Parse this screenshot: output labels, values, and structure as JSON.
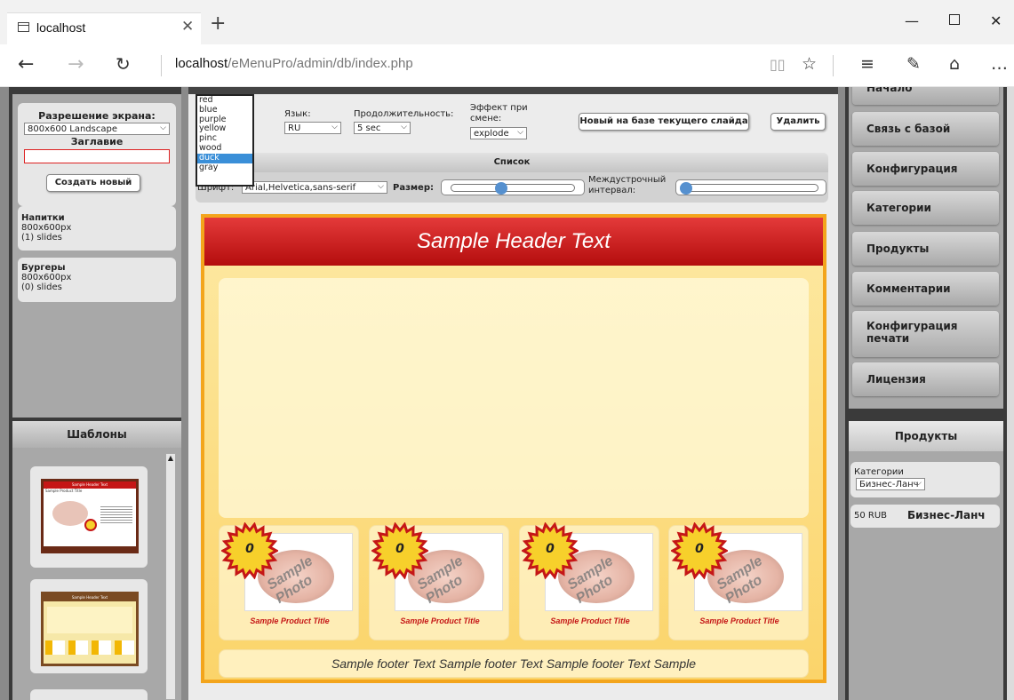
{
  "browser": {
    "tab_title": "localhost",
    "url_host": "localhost",
    "url_path": "/eMenuPro/admin/db/index.php"
  },
  "left": {
    "resolution_label": "Разрешение экрана:",
    "resolution_value": "800x600 Landscape",
    "title_label": "Заглавие",
    "title_value": "",
    "create_button": "Создать новый",
    "groups": [
      {
        "name": "Напитки",
        "size": "800x600px",
        "count": "(1) slides"
      },
      {
        "name": "Бургеры",
        "size": "800x600px",
        "count": "(0) slides"
      }
    ],
    "templates_header": "Шаблоны",
    "template_thumb_header": "Sample Header Text",
    "template_thumb_title": "Sample Product Title"
  },
  "toolbar": {
    "language_label": "Язык:",
    "language_value": "RU",
    "duration_label": "Продолжительность:",
    "duration_value": "5 sec",
    "effect_label": "Эффект при смене:",
    "effect_value": "explode",
    "new_from_current_button": "Новый на базе текущего слайда",
    "delete_button": "Удалить",
    "list_header": "Список",
    "font_label": "Шрифт:",
    "font_value": "Arial,Helvetica,sans-serif",
    "size_label": "Размер:",
    "size_slider_value": 0.4,
    "line_spacing_label": "Междустрочный интервал:",
    "line_spacing_slider_value": 0.0
  },
  "color_dropdown": {
    "options": [
      "red",
      "blue",
      "purple",
      "yellow",
      "pinc",
      "wood",
      "duck",
      "gray"
    ],
    "selected": "duck"
  },
  "slide": {
    "header": "Sample Header Text",
    "products": [
      {
        "badge": "0",
        "title": "Sample Product Title",
        "photo_watermark": "Sample Photo"
      },
      {
        "badge": "0",
        "title": "Sample Product Title",
        "photo_watermark": "Sample Photo"
      },
      {
        "badge": "0",
        "title": "Sample Product Title",
        "photo_watermark": "Sample Photo"
      },
      {
        "badge": "0",
        "title": "Sample Product Title",
        "photo_watermark": "Sample Photo"
      }
    ],
    "footer": "Sample footer Text Sample footer Text Sample footer Text Sample"
  },
  "right": {
    "nav_items": [
      "Начало",
      "Связь с базой",
      "Конфигурация",
      "Категории",
      "Продукты",
      "Комментарии",
      "Конфигурация печати",
      "Лицензия"
    ],
    "products_header": "Продукты",
    "categories_label": "Категории",
    "categories_value": "Бизнес-Ланч",
    "product_price": "50 RUB",
    "product_name": "Бизнес-Ланч"
  },
  "colors": {
    "header_red": "#c8141b",
    "slide_border": "#f3a51c",
    "selected_option": "#3a8fd8"
  }
}
